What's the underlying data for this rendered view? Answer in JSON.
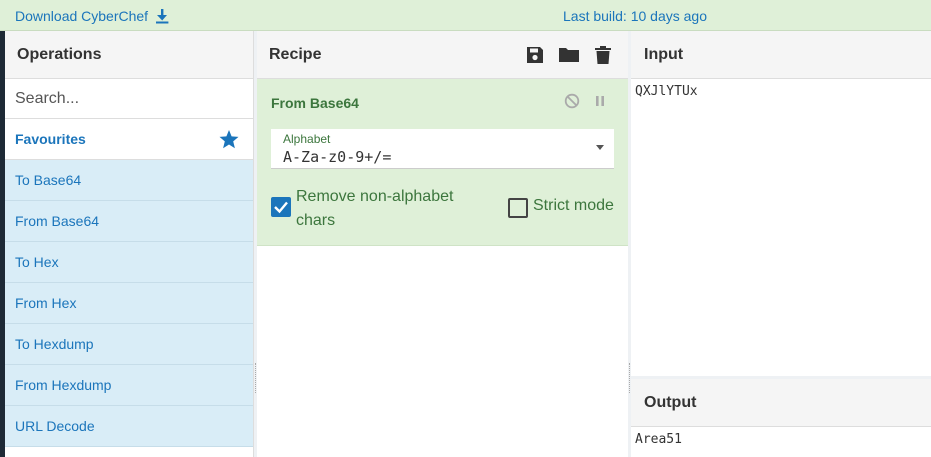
{
  "topbar": {
    "download_label": "Download CyberChef",
    "last_build": "Last build: 10 days ago"
  },
  "operations": {
    "title": "Operations",
    "search_placeholder": "Search...",
    "favourites_label": "Favourites",
    "items": [
      {
        "label": "To Base64"
      },
      {
        "label": "From Base64"
      },
      {
        "label": "To Hex"
      },
      {
        "label": "From Hex"
      },
      {
        "label": "To Hexdump"
      },
      {
        "label": "From Hexdump"
      },
      {
        "label": "URL Decode"
      }
    ]
  },
  "recipe": {
    "title": "Recipe",
    "icons": [
      "save-icon",
      "folder-icon",
      "trash-icon"
    ],
    "operation": {
      "title": "From Base64",
      "alphabet_label": "Alphabet",
      "alphabet_value": "A-Za-z0-9+/=",
      "remove_label": "Remove non-alphabet chars",
      "remove_checked": true,
      "strict_label": "Strict mode",
      "strict_checked": false
    }
  },
  "io": {
    "input_title": "Input",
    "input_value": "QXJlYTUx",
    "output_title": "Output",
    "output_value": "Area51"
  },
  "colors": {
    "accent": "#1b75bb",
    "recipe_op_bg": "#dff0d8",
    "op_item_bg": "#d9edf7",
    "label_green": "#3c763d"
  }
}
